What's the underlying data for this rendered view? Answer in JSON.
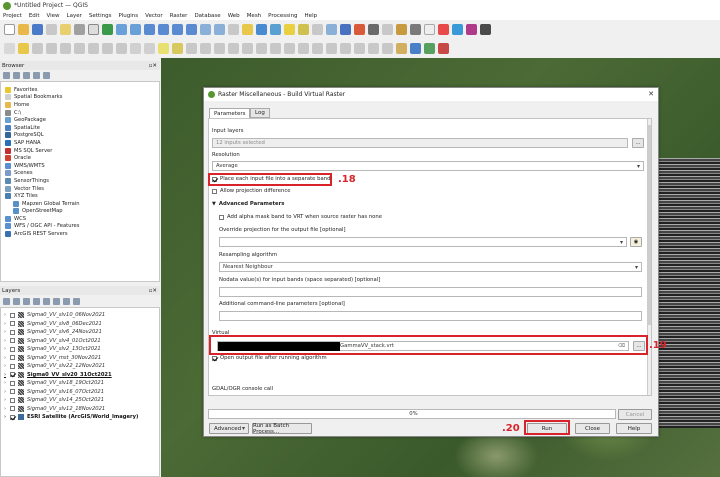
{
  "window": {
    "title": "*Untitled Project — QGIS"
  },
  "menu": [
    "Project",
    "Edit",
    "View",
    "Layer",
    "Settings",
    "Plugins",
    "Vector",
    "Raster",
    "Database",
    "Web",
    "Mesh",
    "Processing",
    "Help"
  ],
  "browser": {
    "title": "Browser",
    "items": [
      "Favorites",
      "Spatial Bookmarks",
      "Home",
      "C:\\",
      "GeoPackage",
      "SpatiaLite",
      "PostgreSQL",
      "SAP HANA",
      "MS SQL Server",
      "Oracle",
      "WMS/WMTS",
      "Scenes",
      "SensorThings",
      "Vector Tiles",
      "XYZ Tiles",
      "Mapzen Global Terrain",
      "OpenStreetMap",
      "WCS",
      "WFS / OGC API - Features",
      "ArcGIS REST Servers"
    ]
  },
  "layers": {
    "title": "Layers",
    "items": [
      "Sigma0_VV_slv10_06Nov2021",
      "Sigma0_VV_slv8_06Dec2021",
      "Sigma0_VV_slv6_24Nov2021",
      "Sigma0_VV_slv4_01Oct2021",
      "Sigma0_VV_slv2_13Oct2021",
      "Sigma0_VV_mst_30Nov2021",
      "Sigma0_VV_slv22_12Nov2021",
      "Sigma0_VV_slv20_31Oct2021",
      "Sigma0_VV_slv18_19Oct2021",
      "Sigma0_VV_slv16_07Oct2021",
      "Sigma0_VV_slv14_25Oct2021",
      "Sigma0_VV_slv12_18Nov2021",
      "ESRI Satellite (ArcGIS/World_Imagery)"
    ]
  },
  "dialog": {
    "title": "Raster Miscellaneous - Build Virtual Raster",
    "tabs": [
      "Parameters",
      "Log"
    ],
    "input_layers_label": "Input layers",
    "input_layers_value": "12 inputs selected",
    "resolution_label": "Resolution",
    "resolution_value": "Average",
    "separate_label": "Place each input file into a separate band",
    "projdiff_label": "Allow projection difference",
    "advanced_label": "Advanced Parameters",
    "alpha_label": "Add alpha mask band to VRT when source raster has none",
    "override_label": "Override projection for the output file [optional]",
    "resampling_label": "Resampling algorithm",
    "resampling_value": "Nearest Neighbour",
    "nodata_label": "Nodata value(s) for input bands (space separated) [optional]",
    "cmdline_label": "Additional command-line parameters [optional]",
    "virtual_label": "Virtual",
    "virtual_value": "GammaVV_stack.vrt",
    "open_label": "Open output file after running algorithm",
    "console_label": "GDAL/OGR console call",
    "progress": "0%",
    "cancel": "Cancel",
    "advanced_btn": "Advanced",
    "batch_btn": "Run as Batch Process...",
    "run": "Run",
    "close": "Close",
    "help": "Help",
    "dots": "..."
  },
  "annotations": {
    "a18": ".18",
    "a19": ".19",
    "a20": ".20"
  }
}
